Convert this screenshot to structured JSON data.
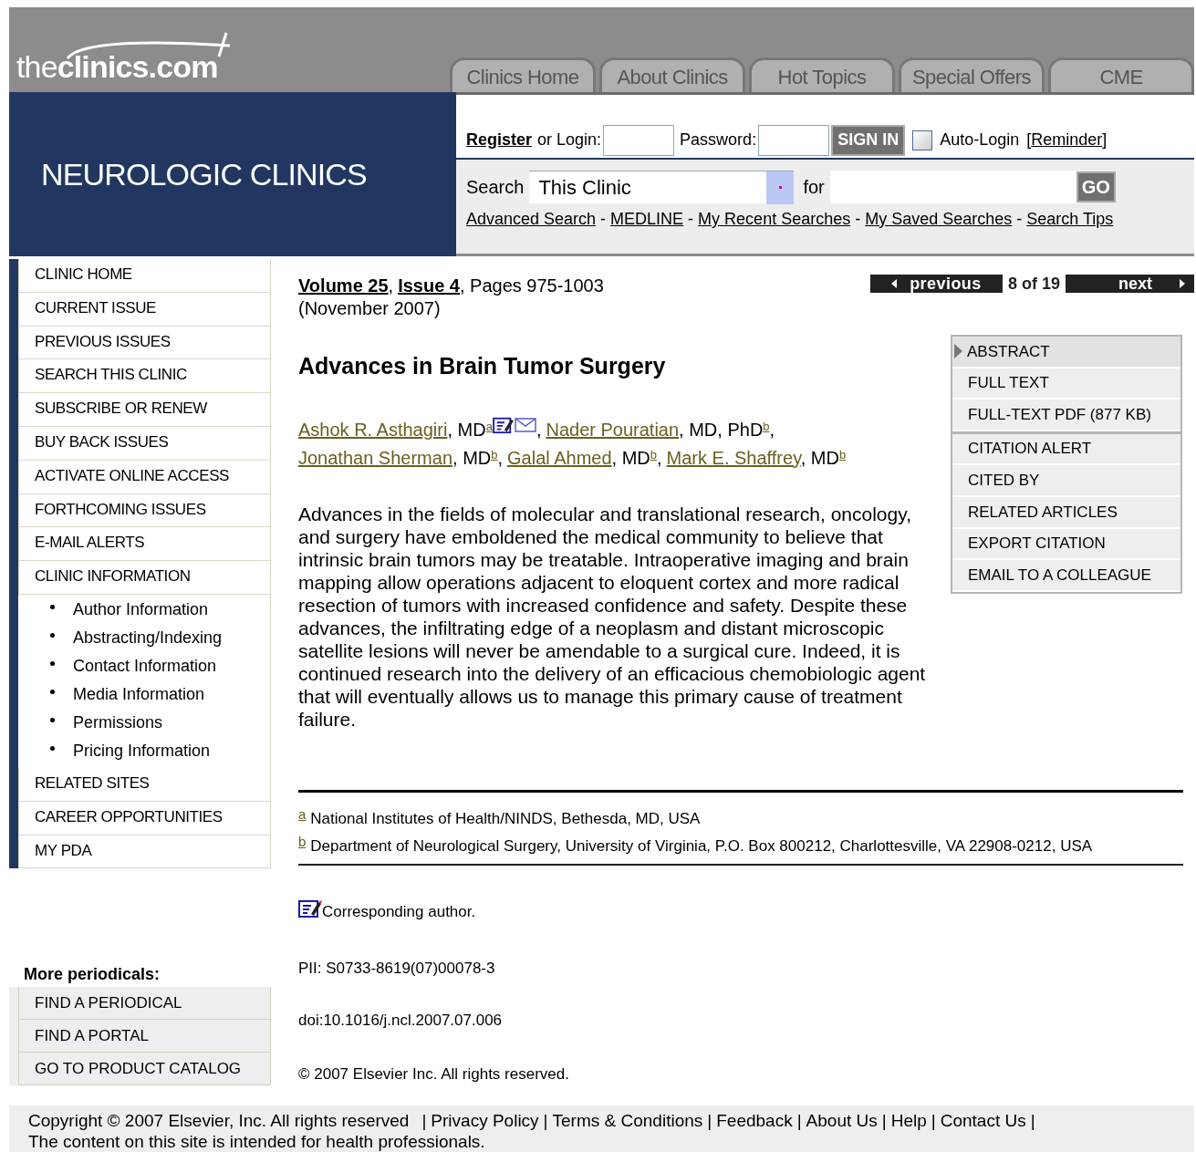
{
  "header": {
    "logo": {
      "light": "the",
      "bold": "clinics.com"
    },
    "journal": "NEUROLOGIC CLINICS",
    "tabs": [
      {
        "label": "Clinics Home",
        "selected": false
      },
      {
        "label": "About Clinics",
        "selected": false
      },
      {
        "label": "Hot Topics",
        "selected": false
      },
      {
        "label": "Special Offers",
        "selected": false
      },
      {
        "label": "CME",
        "selected": false
      }
    ],
    "login": {
      "register": "Register",
      "or_login": "or Login:",
      "password": "Password:",
      "sign_in": "SIGN IN",
      "auto_login": "Auto-Login",
      "auto_login_checked": false,
      "reminder_open": "[",
      "reminder": "Reminder",
      "reminder_close": "]"
    },
    "search": {
      "label": "Search",
      "scope": "This Clinic",
      "for": "for",
      "go": "GO",
      "separator": "-",
      "links": [
        "Advanced Search",
        "MEDLINE",
        "My Recent Searches",
        "My Saved Searches",
        "Search Tips"
      ]
    }
  },
  "sidebar": {
    "items": [
      {
        "label": "CLINIC HOME"
      },
      {
        "label": "CURRENT ISSUE"
      },
      {
        "label": "PREVIOUS ISSUES"
      },
      {
        "label": "SEARCH THIS CLINIC"
      },
      {
        "label": "SUBSCRIBE OR RENEW"
      },
      {
        "label": "BUY BACK ISSUES"
      },
      {
        "label": "ACTIVATE ONLINE ACCESS"
      },
      {
        "label": "FORTHCOMING ISSUES"
      },
      {
        "label": "E-MAIL ALERTS"
      },
      {
        "label": "CLINIC INFORMATION",
        "children": [
          {
            "label": "Author Information"
          },
          {
            "label": "Abstracting/Indexing"
          },
          {
            "label": "Contact Information"
          },
          {
            "label": "Media Information"
          },
          {
            "label": "Permissions"
          },
          {
            "label": "Pricing Information"
          }
        ]
      },
      {
        "label": "RELATED SITES"
      },
      {
        "label": "CAREER OPPORTUNITIES"
      },
      {
        "label": "MY PDA"
      }
    ],
    "more_heading": "More periodicals:",
    "more_items": [
      "FIND A PERIODICAL",
      "FIND A PORTAL",
      "GO TO PRODUCT CATALOG"
    ]
  },
  "article": {
    "volume": "Volume 25",
    "volume_separator": ",",
    "issue": "Issue 4",
    "author_separator": ",",
    "pages": ", Pages 975-1003",
    "date": "(November 2007)",
    "pager": {
      "previous": "previous",
      "position": "8 of 19",
      "next": "next"
    },
    "title": "Advances in Brain Tumor Surgery",
    "authors": [
      {
        "name": "Ashok R. Asthagiri",
        "degrees": ", MD",
        "marks": [
          "a"
        ],
        "corresponding": true,
        "email": true
      },
      {
        "name": "Nader Pouratian",
        "degrees": ", MD, PhD",
        "marks": [
          "b"
        ],
        "corresponding": false,
        "email": false
      },
      {
        "name": "Jonathan Sherman",
        "degrees": ", MD",
        "marks": [
          "b"
        ],
        "corresponding": false,
        "email": false
      },
      {
        "name": "Galal Ahmed",
        "degrees": ", MD",
        "marks": [
          "b"
        ],
        "corresponding": false,
        "email": false
      },
      {
        "name": "Mark E. Shaffrey",
        "degrees": ", MD",
        "marks": [
          "b"
        ],
        "corresponding": false,
        "email": false
      }
    ],
    "abstract": "Advances in the fields of molecular and translational research, oncology, and surgery have emboldened the medical community to believe that intrinsic brain tumors may be treatable. Intraoperative imaging and brain mapping allow operations adjacent to eloquent cortex and more radical resection of tumors with increased confidence and safety. Despite these advances, the infiltrating edge of a neoplasm and distant microscopic satellite lesions will never be amendable to a surgical cure. Indeed, it is continued research into the delivery of an efficacious chemobiologic agent that will eventually allows us to manage this primary cause of treatment failure.",
    "affiliations": [
      {
        "mark": "a",
        "text": "National Institutes of Health/NINDS, Bethesda, MD, USA"
      },
      {
        "mark": "b",
        "text": "Department of Neurological Surgery, University of Virginia, P.O. Box 800212, Charlottesville, VA 22908-0212, USA"
      }
    ],
    "corresponding_note": "Corresponding author.",
    "pii": "PII: S0733-8619(07)00078-3",
    "doi": "doi:10.1016/j.ncl.2007.07.006",
    "rights": "© 2007 Elsevier Inc. All rights reserved.",
    "tools": [
      [
        {
          "label": "ABSTRACT",
          "selected": true
        },
        {
          "label": "FULL TEXT",
          "selected": false
        },
        {
          "label": "FULL-TEXT PDF (877 KB)",
          "selected": false
        }
      ],
      [
        {
          "label": "CITATION ALERT",
          "selected": false
        },
        {
          "label": "CITED BY",
          "selected": false
        },
        {
          "label": "RELATED ARTICLES",
          "selected": false
        },
        {
          "label": "EXPORT CITATION",
          "selected": false
        },
        {
          "label": "EMAIL TO A COLLEAGUE",
          "selected": false
        }
      ]
    ]
  },
  "footer": {
    "separator": "|",
    "copyright": "Copyright © 2007 Elsevier, Inc. All rights reserved",
    "links": [
      "Privacy Policy",
      "Terms & Conditions",
      "Feedback",
      "About Us",
      "Help",
      "Contact Us"
    ],
    "notice": "The content on this site is intended for health professionals."
  }
}
